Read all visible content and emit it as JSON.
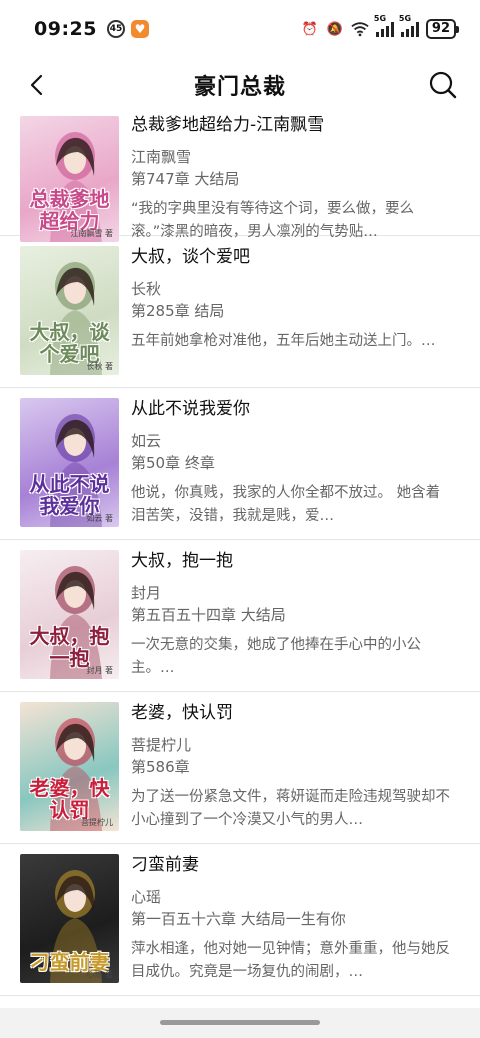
{
  "status_bar": {
    "time": "09:25",
    "network_tag_1": "5G",
    "network_tag_2": "5G",
    "battery": "92"
  },
  "header": {
    "title": "豪门总裁",
    "back_icon": "chevron-left-icon",
    "search_icon": "search-icon"
  },
  "books": [
    {
      "title": "总裁爹地超给力-江南飘雪",
      "author": "江南飘雪",
      "chapter": "第747章  大结局",
      "description": "“我的字典里没有等待这个词，要么做，要么滚。”漆黑的暗夜，男人凛冽的气势贴…",
      "cover_text": "总裁爹地超给力",
      "cover_author": "江南飘雪 著",
      "cover_colors": [
        "#f3d6e6",
        "#e9a7c8",
        "#c94a8a"
      ]
    },
    {
      "title": "大叔，谈个爱吧",
      "author": "长秋",
      "chapter": "第285章 结局",
      "description": "五年前她拿枪对准他，五年后她主动送上门。…",
      "cover_text": "大叔，谈个爱吧",
      "cover_author": "长秋 著",
      "cover_colors": [
        "#e8efe0",
        "#cfdcc2",
        "#6d8a5a"
      ]
    },
    {
      "title": "从此不说我爱你",
      "author": "如云",
      "chapter": "第50章 终章",
      "description": "他说，你真贱，我家的人你全都不放过。  她含着泪苦笑，没错，我就是贱，爱…",
      "cover_text": "从此不说我爱你",
      "cover_author": "如云 著",
      "cover_colors": [
        "#d9c8ef",
        "#a781d6",
        "#5d2f9b"
      ]
    },
    {
      "title": "大叔，抱一抱",
      "author": "封月",
      "chapter": "第五百五十四章 大结局",
      "description": "一次无意的交集，她成了他捧在手心中的小公主。…",
      "cover_text": "大叔，抱一抱",
      "cover_author": "封月 著",
      "cover_colors": [
        "#f6eef0",
        "#e7ced6",
        "#8d1f3c"
      ]
    },
    {
      "title": "老婆，快认罚",
      "author": "菩提柠儿",
      "chapter": "第586章",
      "description": "为了送一份紧急文件，蒋妍诞而走险违规驾驶却不小心撞到了一个冷漠又小气的男人…",
      "cover_text": "老婆，快认罚",
      "cover_author": "菩提柠儿",
      "cover_colors": [
        "#f4e3d4",
        "#88c7c0",
        "#c8203c"
      ]
    },
    {
      "title": "刁蛮前妻",
      "author": "心瑶",
      "chapter": "第一百五十六章 大结局一生有你",
      "description": "萍水相逢，他对她一见钟情；意外重重，他与她反目成仇。究竟是一场复仇的闹剧，…",
      "cover_text": "刁蛮前妻",
      "cover_author": "心瑶 著",
      "cover_colors": [
        "#3a3a3a",
        "#1d1d1d",
        "#c79a2a"
      ]
    }
  ]
}
